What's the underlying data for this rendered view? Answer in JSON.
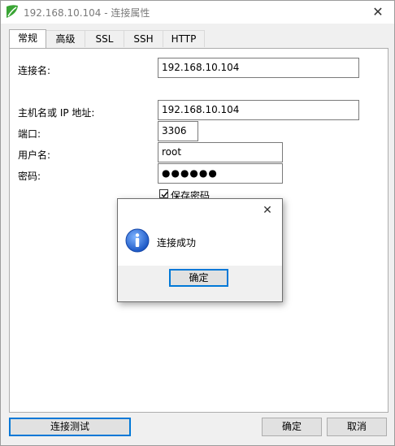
{
  "window": {
    "title": "192.168.10.104 - 连接属性",
    "close_glyph": "✕"
  },
  "tabs": [
    {
      "label": "常规",
      "active": true
    },
    {
      "label": "高级",
      "active": false
    },
    {
      "label": "SSL",
      "active": false
    },
    {
      "label": "SSH",
      "active": false
    },
    {
      "label": "HTTP",
      "active": false
    }
  ],
  "form": {
    "connection_name_label": "连接名:",
    "connection_name_value": "192.168.10.104",
    "host_label": "主机名或 IP 地址:",
    "host_value": "192.168.10.104",
    "port_label": "端口:",
    "port_value": "3306",
    "username_label": "用户名:",
    "username_value": "root",
    "password_label": "密码:",
    "password_dots": "●●●●●●",
    "save_password_label": "保存密码",
    "save_password_checked": true
  },
  "footer": {
    "test_button": "连接测试",
    "ok_button": "确定",
    "cancel_button": "取消"
  },
  "dialog": {
    "close_glyph": "✕",
    "message": "连接成功",
    "ok_button": "确定",
    "icon": "info-icon"
  },
  "colors": {
    "focus_border": "#0078d7",
    "info_blue": "#2a6fd6",
    "brand_green": "#3aa535"
  }
}
